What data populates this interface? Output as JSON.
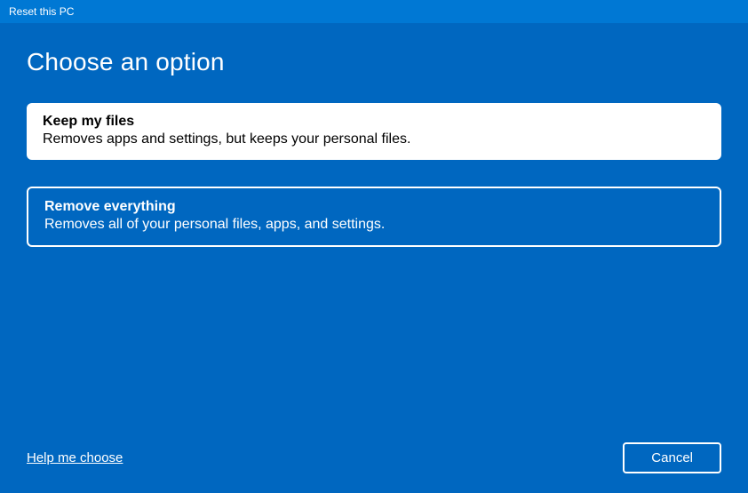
{
  "titlebar": {
    "title": "Reset this PC"
  },
  "heading": "Choose an option",
  "options": [
    {
      "title": "Keep my files",
      "description": "Removes apps and settings, but keeps your personal files."
    },
    {
      "title": "Remove everything",
      "description": "Removes all of your personal files, apps, and settings."
    }
  ],
  "footer": {
    "help_link": "Help me choose",
    "cancel_label": "Cancel"
  }
}
